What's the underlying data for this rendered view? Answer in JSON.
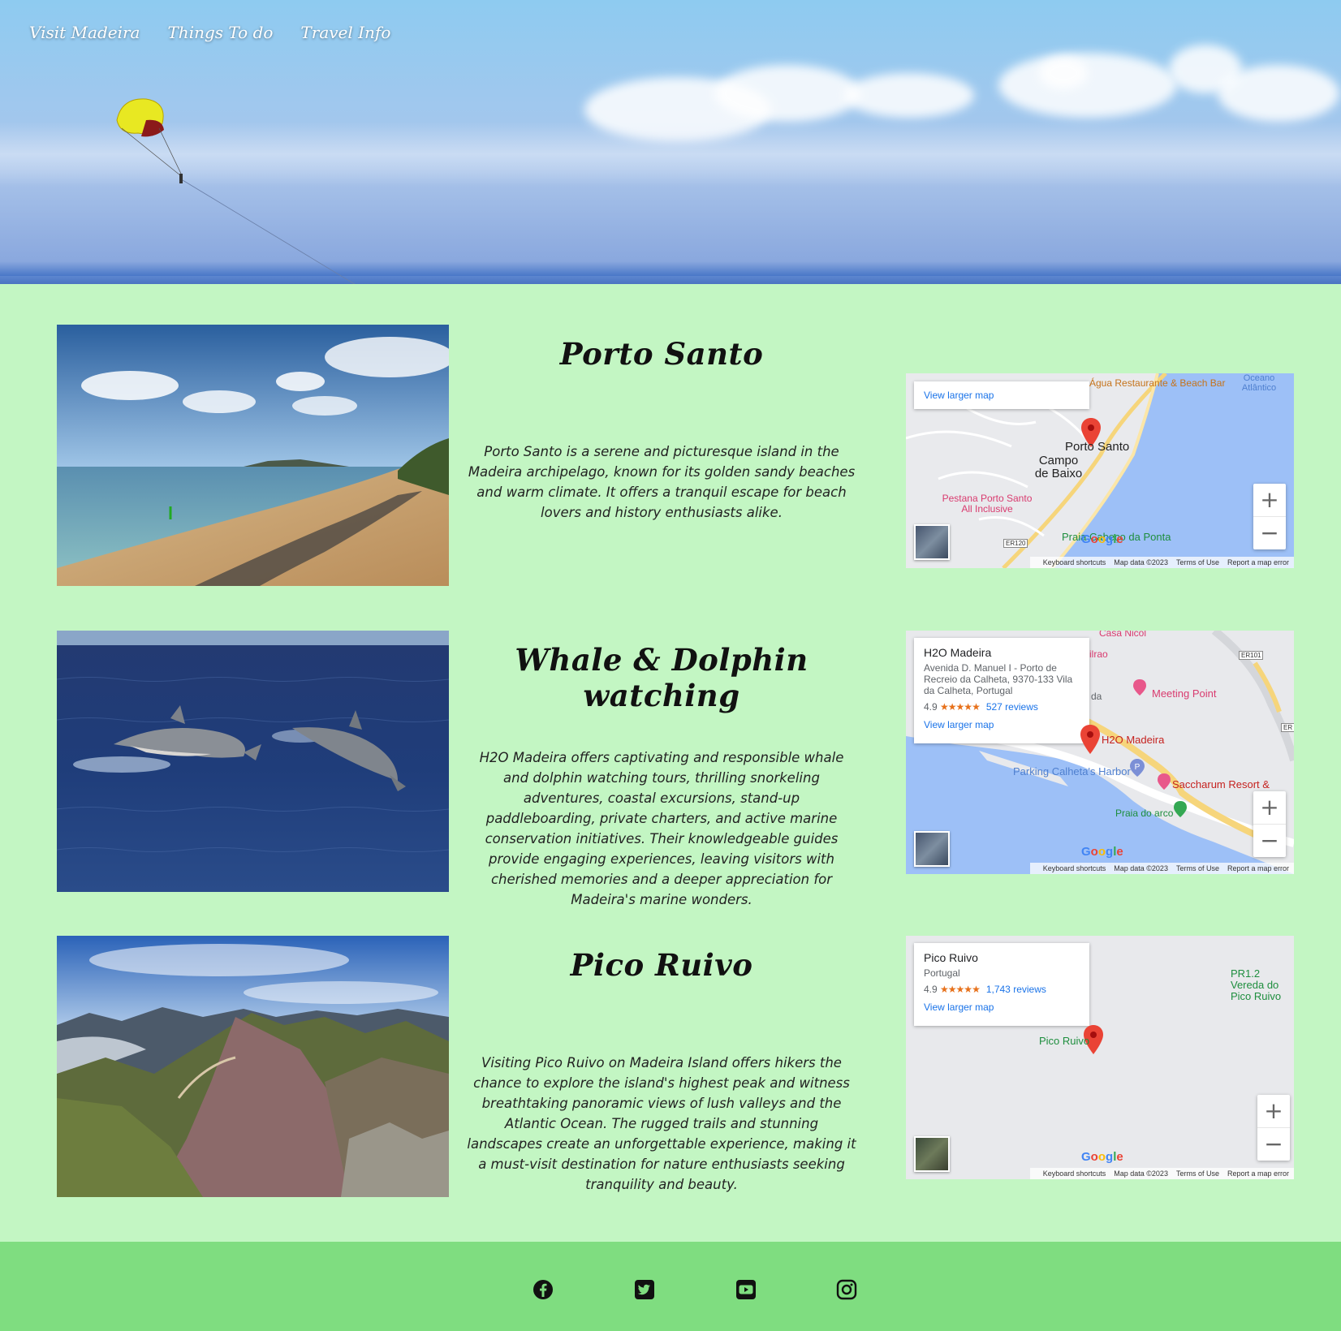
{
  "nav": {
    "items": [
      "Visit Madeira",
      "Things To do",
      "Travel Info"
    ]
  },
  "sections": [
    {
      "title": "Porto Santo",
      "text": "Porto Santo is a serene and picturesque island in the Madeira archipelago, known for its golden sandy beaches and warm climate. It offers a tranquil escape for beach lovers and history enthusiasts alike.",
      "map": {
        "link": "View larger map",
        "labels": [
          "Água Restaurante & Beach Bar",
          "Oceano Atlântico",
          "Porto Santo",
          "Campo de Baixo",
          "Pestana Porto Santo All Inclusive",
          "Praia Cabeço da Ponta",
          "ER120"
        ],
        "footer": [
          "Keyboard shortcuts",
          "Map data ©2023",
          "Terms of Use",
          "Report a map error"
        ],
        "logo": "Google"
      }
    },
    {
      "title": "Whale & Dolphin watching",
      "text": "H2O Madeira offers captivating and responsible whale and dolphin watching tours, thrilling snorkeling adventures, coastal excursions, stand-up paddleboarding, private charters, and active marine conservation initiatives. Their knowledgeable guides provide engaging experiences, leaving visitors with cherished memories and a deeper appreciation for Madeira's marine wonders.",
      "map": {
        "place": "H2O Madeira",
        "address": "Avenida D. Manuel I - Porto de Recreio da Calheta, 9370-133 Vila da Calheta, Portugal",
        "rating": "4.9",
        "stars": "★★★★★",
        "reviews": "527 reviews",
        "link": "View larger map",
        "labels": [
          "Casa Nicol",
          "ilrao",
          "Meeting Point",
          "da",
          "H2O Madeira",
          "Parking Calheta's Harbor",
          "Saccharum Resort &",
          "Praia do arco",
          "ER101",
          "ER"
        ],
        "footer": [
          "Keyboard shortcuts",
          "Map data ©2023",
          "Terms of Use",
          "Report a map error"
        ],
        "logo": "Google"
      }
    },
    {
      "title": "Pico Ruivo",
      "text": "Visiting Pico Ruivo on Madeira Island offers hikers the chance to explore the island's highest peak and witness breathtaking panoramic views of lush valleys and the Atlantic Ocean. The rugged trails and stunning landscapes create an unforgettable experience, making it a must-visit destination for nature enthusiasts seeking tranquility and beauty.",
      "map": {
        "place": "Pico Ruivo",
        "address": "Portugal",
        "rating": "4.9",
        "stars": "★★★★★",
        "reviews": "1,743 reviews",
        "link": "View larger map",
        "labels": [
          "PR1.2 Vereda do Pico Ruivo",
          "Pico Ruivo"
        ],
        "footer": [
          "Keyboard shortcuts",
          "Map data ©2023",
          "Terms of Use",
          "Report a map error"
        ],
        "logo": "Google"
      }
    }
  ],
  "footer": {
    "icons": [
      "facebook-icon",
      "twitter-icon",
      "youtube-icon",
      "instagram-icon"
    ]
  }
}
